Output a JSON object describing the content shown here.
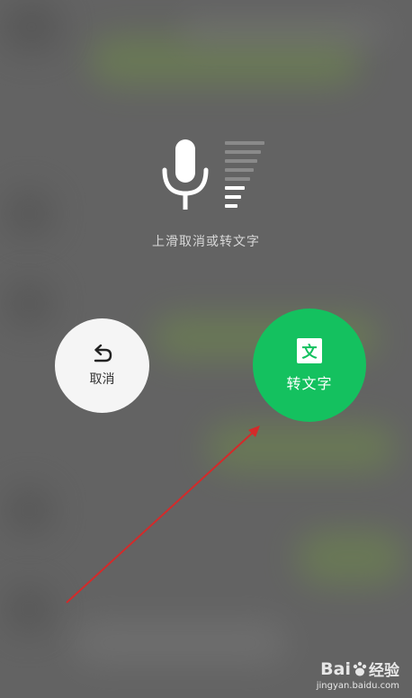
{
  "voice_input": {
    "hint": "上滑取消或转文字"
  },
  "cancel": {
    "label": "取消"
  },
  "transcribe": {
    "label": "转文字",
    "icon_glyph": "文"
  },
  "watermark": {
    "brand": "Bai",
    "brand_suffix": "经验",
    "site": "jingyan.baidu.com"
  },
  "icons": {
    "microphone": "microphone-icon",
    "undo": "undo-arrow-icon",
    "text": "text-wen-icon"
  },
  "colors": {
    "overlay_bg": "#636363",
    "accent_green": "#14c15f",
    "cancel_bg": "#f5f5f5",
    "annotation_arrow": "#d42a2a"
  }
}
